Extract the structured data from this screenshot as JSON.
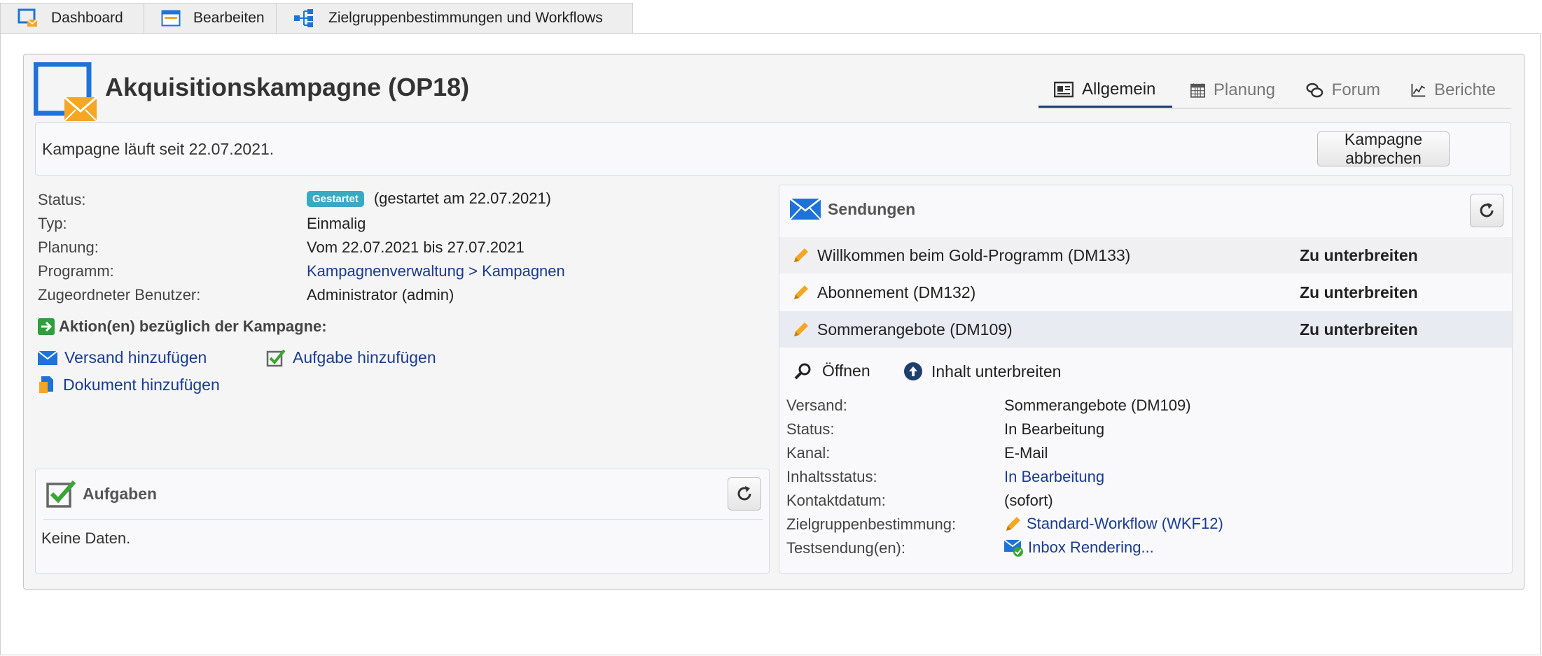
{
  "tabs": [
    {
      "label": "Dashboard",
      "icon": "dashboard-icon"
    },
    {
      "label": "Bearbeiten",
      "icon": "edit-window-icon"
    },
    {
      "label": "Zielgruppenbestimmungen und Workflows",
      "icon": "workflow-icon"
    }
  ],
  "campaign": {
    "title": "Akquisitionskampagne (OP18)",
    "icon": "campaign-envelope-icon"
  },
  "subtabs": [
    {
      "label": "Allgemein",
      "icon": "newspaper-icon"
    },
    {
      "label": "Planung",
      "icon": "calendar-icon"
    },
    {
      "label": "Forum",
      "icon": "chat-icon"
    },
    {
      "label": "Berichte",
      "icon": "line-chart-icon"
    }
  ],
  "infobar": {
    "text": "Kampagne läuft seit 22.07.2021.",
    "abort_button": "Kampagne abbrechen"
  },
  "properties": {
    "status_label": "Status:",
    "status_badge": "Gestartet",
    "status_value": "(gestartet am 22.07.2021)",
    "type_label": "Typ:",
    "type_value": "Einmalig",
    "planning_label": "Planung:",
    "planning_value": "Vom 22.07.2021 bis 27.07.2021",
    "program_label": "Programm:",
    "program_value": "Kampagnenverwaltung > Kampagnen",
    "user_label": "Zugeordneter Benutzer:",
    "user_value": "Administrator (admin)"
  },
  "actions": {
    "title": "Aktion(en) bezüglich der Kampagne:",
    "add_delivery": "Versand hinzufügen",
    "add_task": "Aufgabe hinzufügen",
    "add_document": "Dokument hinzufügen"
  },
  "tasks": {
    "title": "Aufgaben",
    "empty": "Keine Daten."
  },
  "deliveries": {
    "title": "Sendungen",
    "rows": [
      {
        "name": "Willkommen beim Gold-Programm (DM133)",
        "status": "Zu unterbreiten"
      },
      {
        "name": "Abonnement (DM132)",
        "status": "Zu unterbreiten"
      },
      {
        "name": "Sommerangebote (DM109)",
        "status": "Zu unterbreiten"
      }
    ],
    "open_label": "Öffnen",
    "submit_label": "Inhalt unterbreiten",
    "details": {
      "delivery_label": "Versand:",
      "delivery_value": "Sommerangebote (DM109)",
      "status_label": "Status:",
      "status_value": "In Bearbeitung",
      "channel_label": "Kanal:",
      "channel_value": "E-Mail",
      "content_status_label": "Inhaltsstatus:",
      "content_status_value": "In Bearbeitung",
      "contact_date_label": "Kontaktdatum:",
      "contact_date_value": "(sofort)",
      "targeting_label": "Zielgruppenbestimmung:",
      "targeting_value": "Standard-Workflow (WKF12)",
      "proof_label": "Testsendung(en):",
      "proof_value": "Inbox Rendering..."
    }
  },
  "colors": {
    "accent_blue": "#1e73d8",
    "link": "#1a3c8f",
    "badge": "#3aa9c4",
    "envelope_orange": "#f5a623",
    "selected_row": "#e8ebf2"
  }
}
